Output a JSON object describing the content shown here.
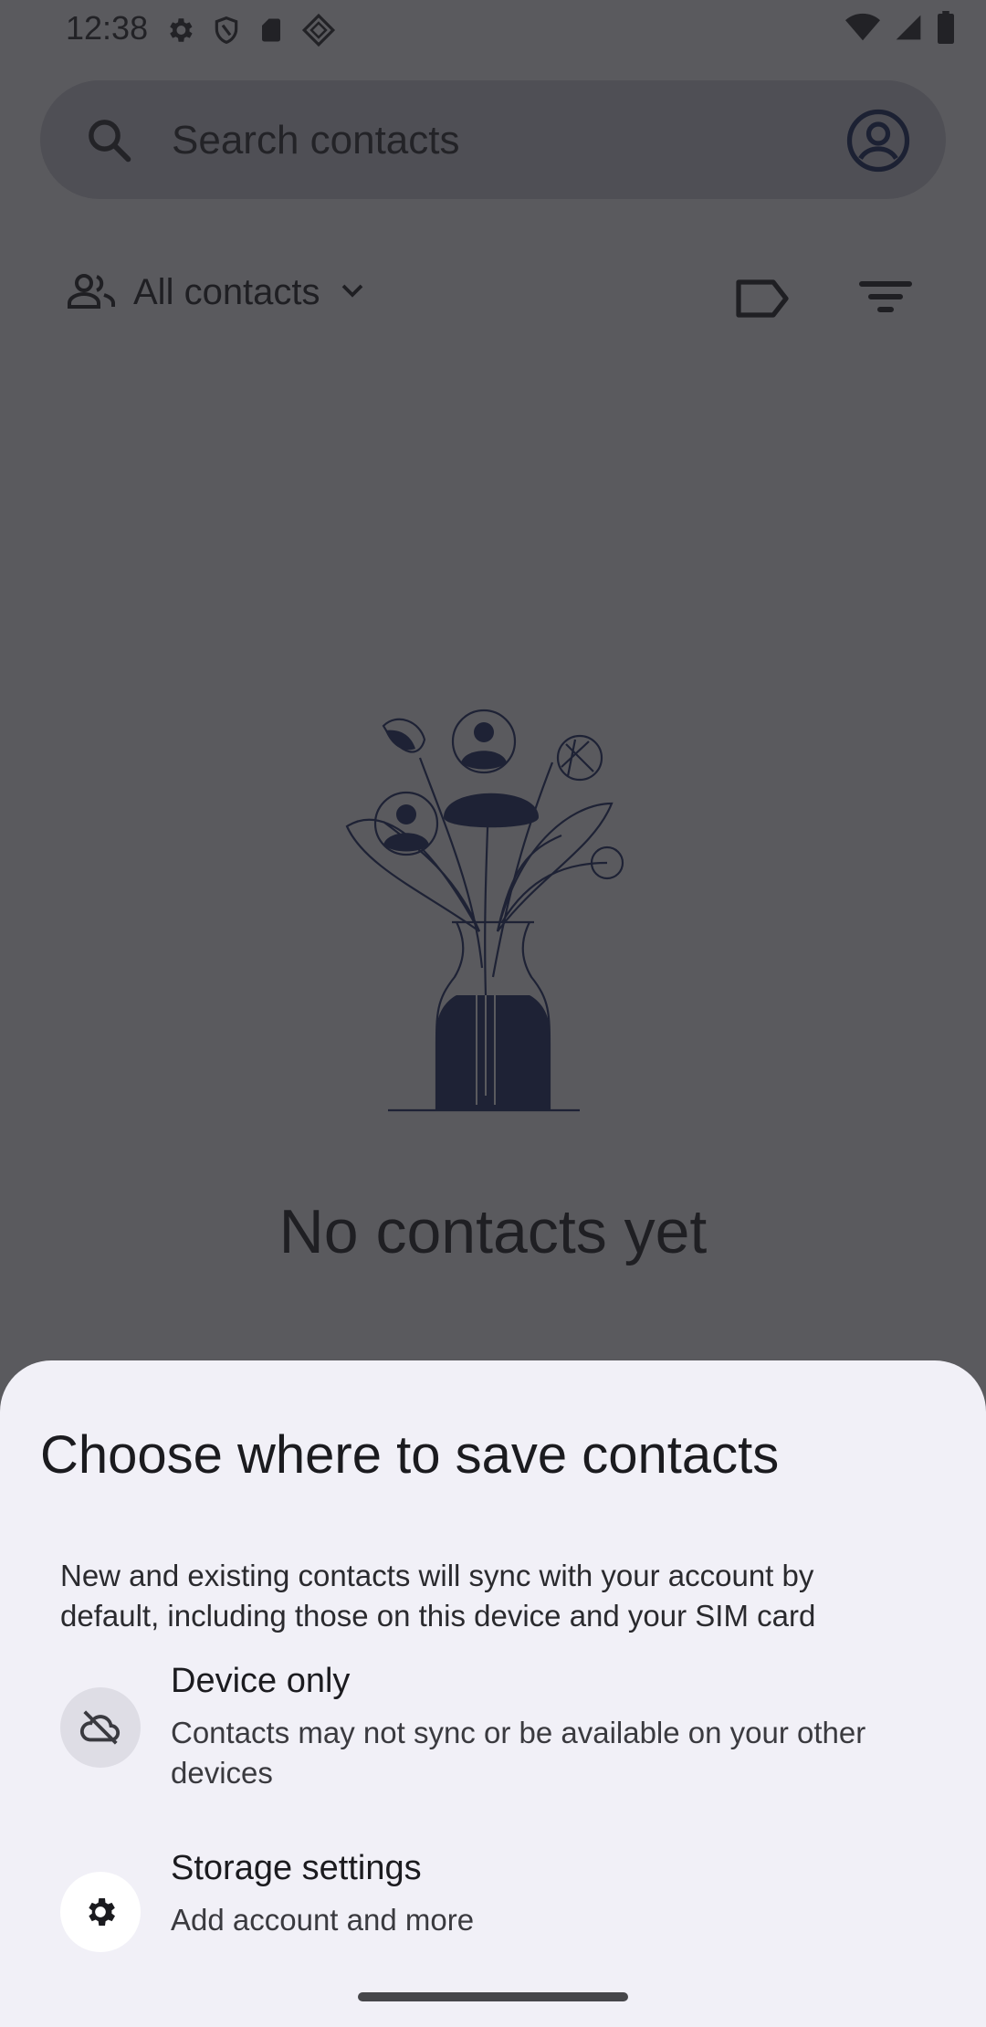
{
  "status_bar": {
    "time": "12:38",
    "left_icons": [
      "settings-icon",
      "shield-icon",
      "sd-card-icon",
      "diamond-icon"
    ],
    "right_icons": [
      "wifi-icon",
      "signal-icon",
      "battery-icon"
    ]
  },
  "search": {
    "placeholder": "Search contacts"
  },
  "filter": {
    "label": "All contacts"
  },
  "empty_state": {
    "title": "No contacts yet"
  },
  "sheet": {
    "title": "Choose where to save contacts",
    "description": "New and existing contacts will sync with your account by default, including those on this device and your SIM card",
    "options": [
      {
        "title": "Device only",
        "subtitle": "Contacts may not sync or be available on your other devices",
        "icon": "cloud-off-icon"
      },
      {
        "title": "Storage settings",
        "subtitle": "Add account and more",
        "icon": "gear-icon"
      }
    ]
  },
  "colors": {
    "scrim_background": "#5a5a5e",
    "sheet_background": "#f1f0f7",
    "illustration_fill": "#1e2235"
  }
}
